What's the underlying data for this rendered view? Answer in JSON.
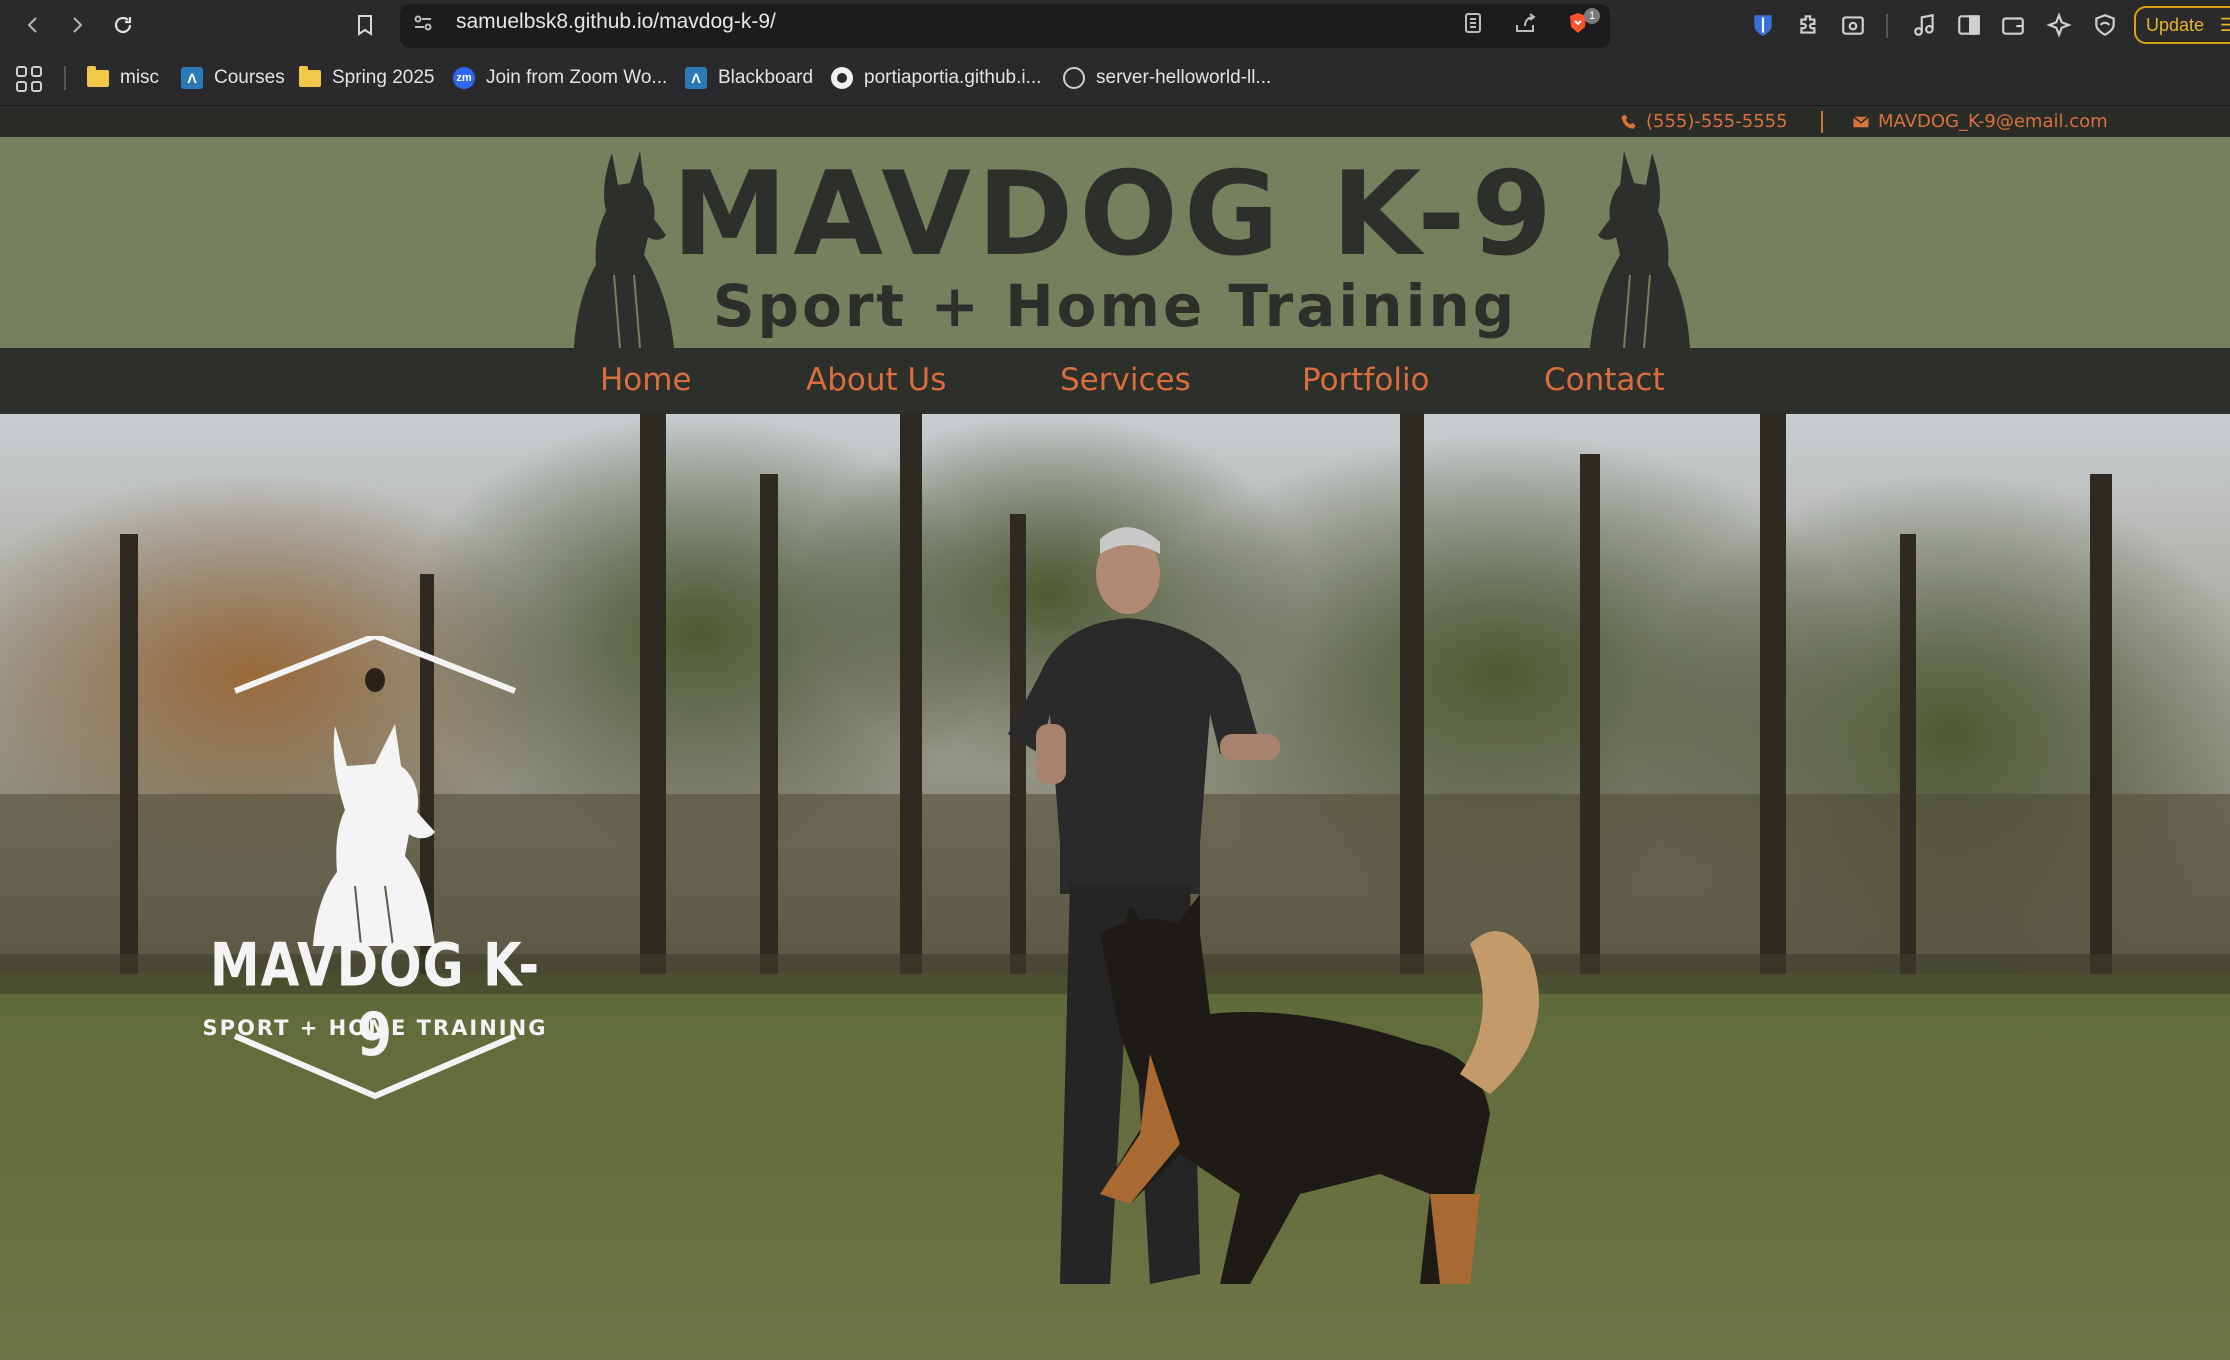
{
  "browser": {
    "url": "samuelbsk8.github.io/mavdog-k-9/",
    "update_label": "Update",
    "brave_badge": "1",
    "bookmarks": [
      {
        "label": "misc",
        "icon": "folder-icon"
      },
      {
        "label": "Courses",
        "icon": "blackboard-icon"
      },
      {
        "label": "Spring 2025",
        "icon": "folder-icon"
      },
      {
        "label": "Join from Zoom Wo...",
        "icon": "zoom-icon"
      },
      {
        "label": "Blackboard",
        "icon": "blackboard-icon"
      },
      {
        "label": "portiaportia.github.i...",
        "icon": "github-icon"
      },
      {
        "label": "server-helloworld-ll...",
        "icon": "globe-icon"
      }
    ]
  },
  "site": {
    "phone": "(555)-555-5555",
    "email": "MAVDOG_K-9@email.com",
    "title": "MAVDOG K-9",
    "subtitle": "Sport + Home Training",
    "nav": [
      "Home",
      "About Us",
      "Services",
      "Portfolio",
      "Contact"
    ],
    "hero_logo_title": "MAVDOG K-9",
    "hero_logo_subtitle": "SPORT + HOME TRAINING"
  },
  "colors": {
    "header_bg": "#76805f",
    "dark_bar": "#2d2f2b",
    "accent_orange": "#d86e3e",
    "title_text": "#2d2f2b"
  }
}
